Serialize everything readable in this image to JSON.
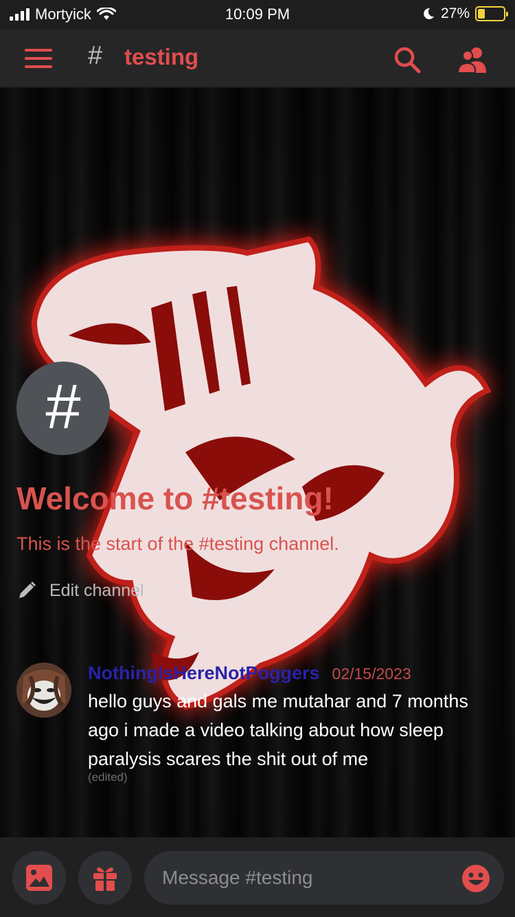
{
  "status_bar": {
    "carrier": "Mortyick",
    "time": "10:09 PM",
    "battery_percent": "27%",
    "battery_level": 0.27
  },
  "header": {
    "hash_symbol": "#",
    "channel_name": "testing"
  },
  "channel_intro": {
    "avatar_symbol": "#",
    "welcome_title": "Welcome to #testing!",
    "welcome_subtitle": "This is the start of the #testing channel.",
    "edit_label": "Edit channel"
  },
  "messages": [
    {
      "author": "NothingIsHereNotPoggers",
      "timestamp": "02/15/2023",
      "text": "hello guys and gals me mutahar and 7 months ago i made a video talking about how sleep paralysis scares the shit out of me",
      "edited_label": "(edited)"
    }
  ],
  "composer": {
    "placeholder": "Message #testing"
  },
  "icons": {
    "menu": "menu-icon",
    "search": "search-icon",
    "members": "members-icon",
    "pencil": "pencil-icon",
    "image": "image-icon",
    "gift": "gift-icon",
    "emoji": "emoji-icon"
  },
  "colors": {
    "accent": "#e24d4d",
    "author": "#2a22a8",
    "timestamp": "#c24a4a",
    "background": "#262627"
  }
}
